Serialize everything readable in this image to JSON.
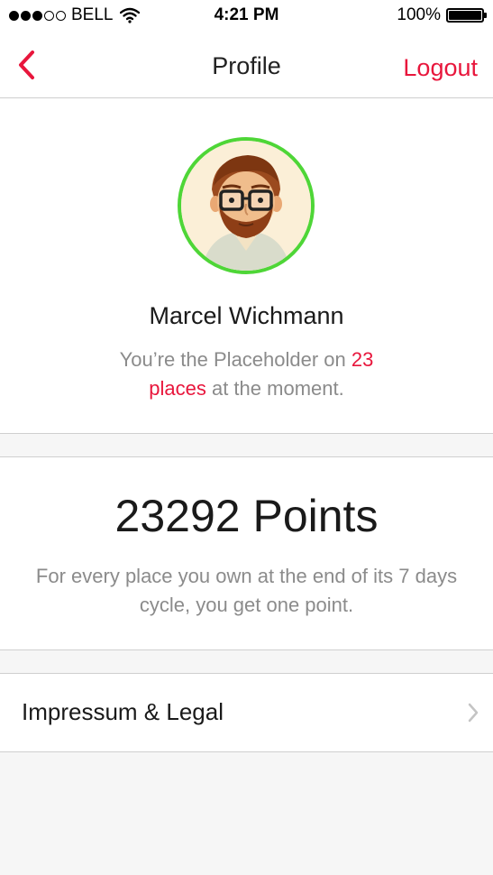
{
  "status_bar": {
    "carrier": "BELL",
    "time": "4:21 PM",
    "battery": "100%",
    "signal_strength": 3,
    "signal_max": 5
  },
  "nav": {
    "title": "Profile",
    "logout_label": "Logout",
    "back_icon": "chevron-left-icon"
  },
  "profile": {
    "name": "Marcel Wichmann",
    "desc_prefix": "You’re the Placeholder on ",
    "desc_highlight": "23 places",
    "desc_suffix": " at the moment.",
    "avatar_icon": "avatar-illustration"
  },
  "points": {
    "value_text": "23292 Points",
    "description": "For every place you own at the end of its 7 days cycle, you get one point."
  },
  "legal": {
    "label": "Impressum & Legal",
    "chevron_icon": "chevron-right-icon"
  },
  "colors": {
    "accent": "#e8163c",
    "avatar_ring": "#4ed637",
    "secondary_text": "#8b8b8b",
    "background": "#f6f6f6"
  }
}
